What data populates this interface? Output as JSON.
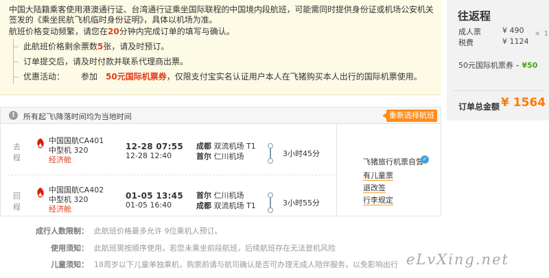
{
  "notice": {
    "warning": "中国大陆籍乘客使用港澳通行证、台湾通行证乘坐国际联程的中国境内段航班，可能需同时提供身份证或机场公安机关签发的《乘坐民航飞机临时身份证明》，具体以机场为准。",
    "deadline_prefix": "航班价格变动频繁，请您在",
    "deadline_minutes": "20",
    "deadline_suffix": "分钟内完成订单的填写与确认。",
    "remaining_prefix": "此航班价格剩余票数",
    "remaining_count": "5",
    "remaining_suffix": "张，请及时预订。",
    "pay_tip": "订单提交后，请及时付款并联系代理商出票。",
    "promo_label": "优惠活动：",
    "promo_prefix": "参加",
    "promo_amount": "50元国际机票券",
    "promo_suffix": "，仅限支付宝实名认证用户本人在飞猪购买本人出行的国际机票使用。"
  },
  "summary": {
    "title": "往返程",
    "adult_label": "成人票",
    "adult_price": "¥ 490",
    "tax_label": "税费",
    "tax_price": "¥ 1124",
    "multiplier_x": "×",
    "multiplier_n": "1",
    "coupon_label": "50元国际机票券",
    "coupon_value": "- ¥50",
    "total_label": "订单总金额",
    "total_value": "¥ 1564"
  },
  "flight": {
    "header_text": "所有起飞\\降落时间均为当地时间",
    "header_icon": "info-icon",
    "reselect_label": "重新选择航班",
    "legs": [
      {
        "direction": "去程",
        "airline": "中国国航CA401",
        "aircraft": "中型机  320",
        "cabin": "经济舱",
        "dep_time": "12-28 07:55",
        "arr_time": "12-28 12:40",
        "dep_city": "成都",
        "dep_airport": "双流机场  T1",
        "arr_city": "首尔",
        "arr_airport": "仁川机场",
        "duration": "3小时45分"
      },
      {
        "direction": "回程",
        "airline": "中国国航CA402",
        "aircraft": "中型机  320",
        "cabin": "经济舱",
        "dep_time": "01-05 13:45",
        "arr_time": "01-05 16:40",
        "dep_city": "首尔",
        "dep_airport": "仁川机场",
        "arr_city": "成都",
        "arr_airport": "双流机场  T1",
        "duration": "3小时55分"
      }
    ],
    "vendor": "飞猪旅行机票自营",
    "vendor_links": [
      "有儿童票",
      "退改签",
      "行李规定"
    ]
  },
  "notes": [
    {
      "key": "成行人数限制：",
      "value": "此航班价格最多允许 9位乘机人预订。"
    },
    {
      "key": "使用须知：",
      "value": "此航班需按顺序使用，若您未乘坐前段航班，后续航班存在无法登机风险"
    },
    {
      "key": "儿童须知：",
      "value": "18周岁以下儿童单独乘机，购票前请与航司确认是否可办理无成人陪伴服务，以免影响出行"
    }
  ],
  "watermark": "eLvXing.net",
  "colors": {
    "accent_orange": "#ff8c1a",
    "price_red": "#e23b18",
    "coupon_green": "#4aa31a",
    "notice_bg": "#fdfbe6"
  }
}
